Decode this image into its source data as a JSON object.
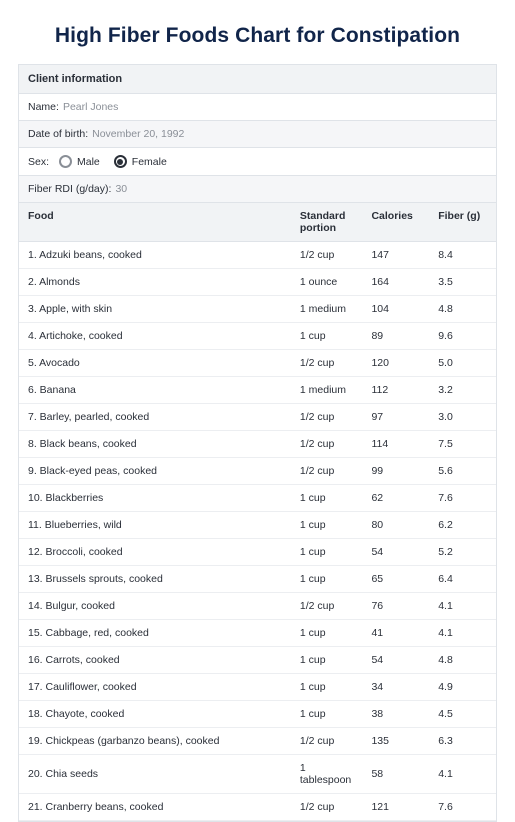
{
  "title": "High Fiber Foods Chart for Constipation",
  "client_section": {
    "heading": "Client information",
    "name_label": "Name:",
    "name_value": "Pearl Jones",
    "dob_label": "Date of birth:",
    "dob_value": "November 20, 1992",
    "sex_label": "Sex:",
    "sex_options": {
      "male": "Male",
      "female": "Female"
    },
    "sex_selected": "female",
    "rdi_label": "Fiber RDI (g/day):",
    "rdi_value": "30"
  },
  "columns": {
    "food": "Food",
    "portion": "Standard portion",
    "calories": "Calories",
    "fiber": "Fiber (g)"
  },
  "rows": [
    {
      "n": "1.",
      "food": "Adzuki beans, cooked",
      "portion": "1/2 cup",
      "cal": "147",
      "fiber": "8.4"
    },
    {
      "n": "2.",
      "food": "Almonds",
      "portion": "1 ounce",
      "cal": "164",
      "fiber": "3.5"
    },
    {
      "n": "3.",
      "food": "Apple, with skin",
      "portion": "1 medium",
      "cal": "104",
      "fiber": "4.8"
    },
    {
      "n": "4.",
      "food": "Artichoke, cooked",
      "portion": "1 cup",
      "cal": "89",
      "fiber": "9.6"
    },
    {
      "n": "5.",
      "food": "Avocado",
      "portion": "1/2 cup",
      "cal": "120",
      "fiber": "5.0"
    },
    {
      "n": "6.",
      "food": "Banana",
      "portion": "1 medium",
      "cal": "112",
      "fiber": "3.2"
    },
    {
      "n": "7.",
      "food": "Barley, pearled, cooked",
      "portion": "1/2 cup",
      "cal": "97",
      "fiber": "3.0"
    },
    {
      "n": "8.",
      "food": "Black beans, cooked",
      "portion": "1/2 cup",
      "cal": "114",
      "fiber": "7.5"
    },
    {
      "n": "9.",
      "food": "Black-eyed peas, cooked",
      "portion": "1/2 cup",
      "cal": "99",
      "fiber": "5.6"
    },
    {
      "n": "10.",
      "food": "Blackberries",
      "portion": "1 cup",
      "cal": "62",
      "fiber": "7.6"
    },
    {
      "n": "11.",
      "food": "Blueberries, wild",
      "portion": "1 cup",
      "cal": "80",
      "fiber": "6.2"
    },
    {
      "n": "12.",
      "food": "Broccoli, cooked",
      "portion": "1 cup",
      "cal": "54",
      "fiber": "5.2"
    },
    {
      "n": "13.",
      "food": "Brussels sprouts, cooked",
      "portion": "1 cup",
      "cal": "65",
      "fiber": "6.4"
    },
    {
      "n": "14.",
      "food": "Bulgur, cooked",
      "portion": "1/2 cup",
      "cal": "76",
      "fiber": "4.1"
    },
    {
      "n": "15.",
      "food": "Cabbage, red, cooked",
      "portion": "1 cup",
      "cal": "41",
      "fiber": "4.1"
    },
    {
      "n": "16.",
      "food": "Carrots, cooked",
      "portion": "1 cup",
      "cal": "54",
      "fiber": "4.8"
    },
    {
      "n": "17.",
      "food": "Cauliflower, cooked",
      "portion": "1 cup",
      "cal": "34",
      "fiber": "4.9"
    },
    {
      "n": "18.",
      "food": "Chayote, cooked",
      "portion": "1 cup",
      "cal": "38",
      "fiber": "4.5"
    },
    {
      "n": "19.",
      "food": "Chickpeas (garbanzo beans), cooked",
      "portion": "1/2 cup",
      "cal": "135",
      "fiber": "6.3"
    },
    {
      "n": "20.",
      "food": "Chia seeds",
      "portion": "1 tablespoon",
      "cal": "58",
      "fiber": "4.1"
    },
    {
      "n": "21.",
      "food": "Cranberry beans, cooked",
      "portion": "1/2 cup",
      "cal": "121",
      "fiber": "7.6"
    }
  ]
}
